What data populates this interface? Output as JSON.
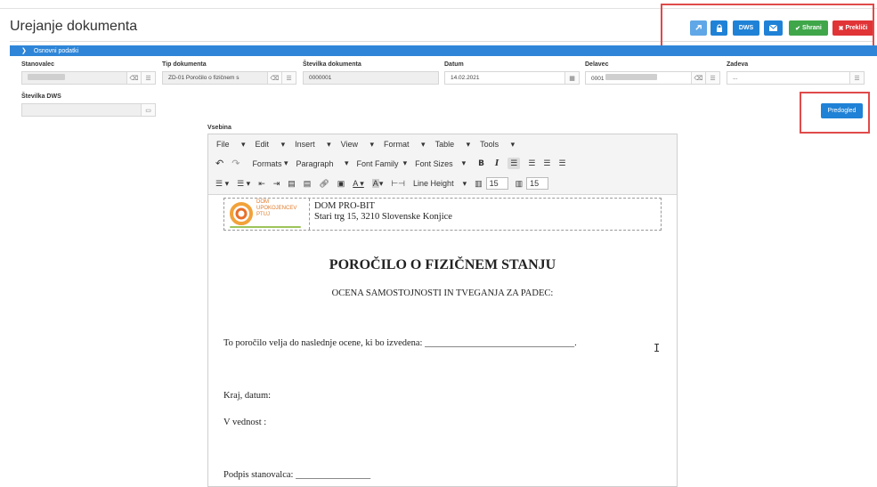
{
  "page": {
    "title": "Urejanje dokumenta"
  },
  "actions": {
    "dws_label": "DWS",
    "save_label": "Shrani",
    "cancel_label": "Prekliči",
    "preview_label": "Predogled"
  },
  "section": {
    "title": "Osnovni podatki"
  },
  "fields": {
    "resident_label": "Stanovalec",
    "doc_type_label": "Tip dokumenta",
    "doc_type_value": "ZD-01 Poročilo o fizičnem s",
    "doc_number_label": "Številka dokumenta",
    "doc_number_value": "0000001",
    "date_label": "Datum",
    "date_value": "14.02.2021",
    "employee_label": "Delavec",
    "employee_value": "0001",
    "subject_label": "Zadeva",
    "subject_placeholder": "...",
    "dws_number_label": "Številka DWS",
    "content_label": "Vsebina"
  },
  "editor": {
    "menu": [
      "File",
      "Edit",
      "Insert",
      "View",
      "Format",
      "Table",
      "Tools"
    ],
    "toolbar": {
      "formats": "Formats",
      "paragraph": "Paragraph",
      "font_family": "Font Family",
      "font_sizes": "Font Sizes",
      "bold": "B",
      "italic": "I",
      "line_height": "Line Height",
      "cols_value": "15",
      "rows_value": "15"
    },
    "document": {
      "logo_text": [
        "DOM",
        "UPOKOJENCEV",
        "PTUJ"
      ],
      "org_name": "DOM PRO-BIT",
      "org_address": "Stari trg 15, 3210 Slovenske Konjice",
      "title": "POROČILO O FIZIČNEM STANJU",
      "subtitle": "OCENA SAMOSTOJNOSTI IN TVEGANJA ZA PADEC:",
      "validity_line": "To poročilo velja do naslednje ocene, ki bo izvedena: ________________________________.",
      "place_date": "Kraj, datum:",
      "on_behalf": "V vednost :",
      "signature": "Podpis stanovalca: ________________"
    }
  },
  "colors": {
    "section_bar": "#2f86d8",
    "save_button": "#3fa64a",
    "cancel_button": "#e03437",
    "preview_button": "#1f82d6",
    "highlight_box": "#e04a4a"
  }
}
